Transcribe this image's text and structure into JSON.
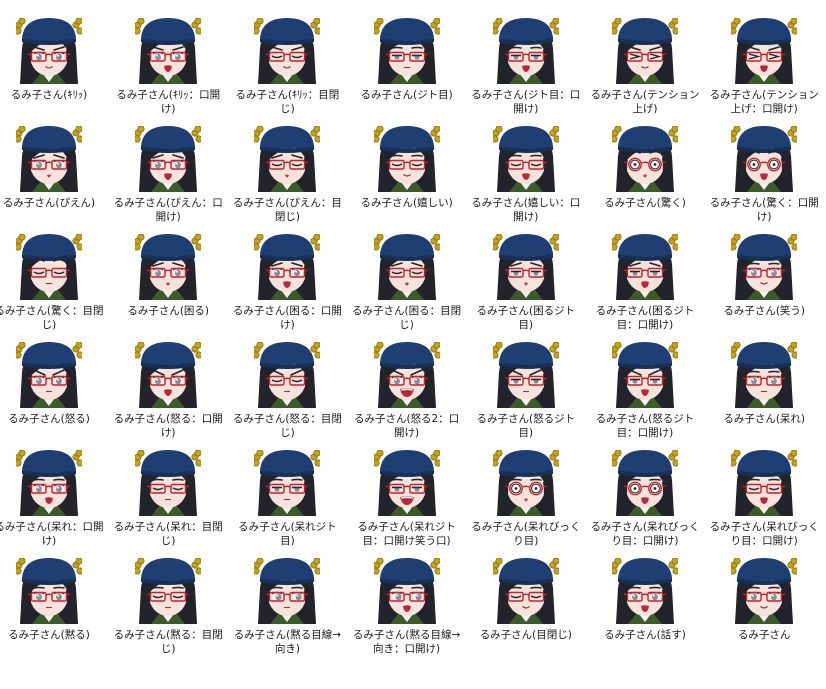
{
  "view": "file-explorer-large-icons",
  "colors": {
    "background": "#ffffff",
    "label_text": "#1a1a1a",
    "hat": "#1f3f73",
    "hat_dark": "#16305a",
    "ribbon": "#c8a20f",
    "hair": "#23232b",
    "skin": "#f6e3dc",
    "glasses_frame": "#c8202a",
    "eye": "#8a8c96",
    "collar": "#3c5a2a"
  },
  "files": [
    {
      "name": "るみ子さん(ｷﾘｯ)",
      "eyes": "normal",
      "brows": "stern",
      "mouth": "smile",
      "glasses": "normal"
    },
    {
      "name": "るみ子さん(ｷﾘｯ：口開け)",
      "eyes": "normal",
      "brows": "stern",
      "mouth": "open",
      "glasses": "normal"
    },
    {
      "name": "るみ子さん(ｷﾘｯ：目閉じ)",
      "eyes": "closed",
      "brows": "stern",
      "mouth": "smile",
      "glasses": "normal"
    },
    {
      "name": "るみ子さん(ジト目)",
      "eyes": "half",
      "brows": "flat",
      "mouth": "flat",
      "glasses": "normal"
    },
    {
      "name": "るみ子さん(ジト目：口開け)",
      "eyes": "half",
      "brows": "flat",
      "mouth": "open",
      "glasses": "normal"
    },
    {
      "name": "るみ子さん(テンション上げ)",
      "eyes": "squint",
      "brows": "stern",
      "mouth": "smile",
      "glasses": "normal"
    },
    {
      "name": "るみ子さん(テンション上げ：口開け)",
      "eyes": "squint",
      "brows": "stern",
      "mouth": "open",
      "glasses": "normal"
    },
    {
      "name": "るみ子さん(ぴえん)",
      "eyes": "normal",
      "brows": "sad",
      "mouth": "small",
      "glasses": "normal"
    },
    {
      "name": "るみ子さん(ぴえん：口開け)",
      "eyes": "normal",
      "brows": "sad",
      "mouth": "open",
      "glasses": "normal"
    },
    {
      "name": "るみ子さん(ぴえん：目閉じ)",
      "eyes": "closed",
      "brows": "sad",
      "mouth": "small",
      "glasses": "normal"
    },
    {
      "name": "るみ子さん(嬉しい)",
      "eyes": "closed",
      "brows": "flat",
      "mouth": "smile",
      "glasses": "normal"
    },
    {
      "name": "るみ子さん(嬉しい：口開け)",
      "eyes": "closed",
      "brows": "flat",
      "mouth": "open",
      "glasses": "normal"
    },
    {
      "name": "るみ子さん(驚く)",
      "eyes": "wide",
      "brows": "surprised",
      "mouth": "small",
      "glasses": "round"
    },
    {
      "name": "るみ子さん(驚く：口開け)",
      "eyes": "wide",
      "brows": "surprised",
      "mouth": "open",
      "glasses": "round"
    },
    {
      "name": "るみ子さん(驚く：目閉じ)",
      "eyes": "closed",
      "brows": "surprised",
      "mouth": "flat",
      "glasses": "normal"
    },
    {
      "name": "るみ子さん(困る)",
      "eyes": "normal",
      "brows": "sad",
      "mouth": "small",
      "glasses": "normal"
    },
    {
      "name": "るみ子さん(困る：口開け)",
      "eyes": "normal",
      "brows": "sad",
      "mouth": "open",
      "glasses": "normal"
    },
    {
      "name": "るみ子さん(困る：目閉じ)",
      "eyes": "closed",
      "brows": "sad",
      "mouth": "small",
      "glasses": "normal"
    },
    {
      "name": "るみ子さん(困るジト目)",
      "eyes": "half",
      "brows": "sad",
      "mouth": "small",
      "glasses": "normal"
    },
    {
      "name": "るみ子さん(困るジト目：口開け)",
      "eyes": "half",
      "brows": "sad",
      "mouth": "open",
      "glasses": "normal"
    },
    {
      "name": "るみ子さん(笑う)",
      "eyes": "normal",
      "brows": "flat",
      "mouth": "smile",
      "glasses": "normal"
    },
    {
      "name": "るみ子さん(怒る)",
      "eyes": "normal",
      "brows": "angry",
      "mouth": "flat",
      "glasses": "normal"
    },
    {
      "name": "るみ子さん(怒る：口開け)",
      "eyes": "normal",
      "brows": "angry",
      "mouth": "open",
      "glasses": "normal"
    },
    {
      "name": "るみ子さん(怒る：目閉じ)",
      "eyes": "closed",
      "brows": "angry",
      "mouth": "flat",
      "glasses": "normal"
    },
    {
      "name": "るみ子さん(怒る2：口開け)",
      "eyes": "normal",
      "brows": "angry",
      "mouth": "wide",
      "glasses": "normal"
    },
    {
      "name": "るみ子さん(怒るジト目)",
      "eyes": "half",
      "brows": "angry",
      "mouth": "flat",
      "glasses": "normal"
    },
    {
      "name": "るみ子さん(怒るジト目：口開け)",
      "eyes": "half",
      "brows": "angry",
      "mouth": "open",
      "glasses": "normal"
    },
    {
      "name": "るみ子さん(呆れ)",
      "eyes": "normal",
      "brows": "flat",
      "mouth": "flat",
      "glasses": "normal"
    },
    {
      "name": "るみ子さん(呆れ：口開け)",
      "eyes": "normal",
      "brows": "flat",
      "mouth": "open",
      "glasses": "normal"
    },
    {
      "name": "るみ子さん(呆れ：目閉じ)",
      "eyes": "closed",
      "brows": "flat",
      "mouth": "flat",
      "glasses": "normal"
    },
    {
      "name": "るみ子さん(呆れジト目)",
      "eyes": "half",
      "brows": "flat",
      "mouth": "flat",
      "glasses": "normal"
    },
    {
      "name": "るみ子さん(呆れジト目：口開け笑う口)",
      "eyes": "half",
      "brows": "flat",
      "mouth": "wide",
      "glasses": "normal"
    },
    {
      "name": "るみ子さん(呆れびっくり目)",
      "eyes": "wide",
      "brows": "flat",
      "mouth": "small",
      "glasses": "round"
    },
    {
      "name": "るみ子さん(呆れびっくり目：口開け)",
      "eyes": "wide",
      "brows": "flat",
      "mouth": "open",
      "glasses": "round"
    },
    {
      "name": "るみ子さん(呆れびっくり目：口開け)",
      "eyes": "closed",
      "brows": "flat",
      "mouth": "open",
      "glasses": "normal"
    },
    {
      "name": "るみ子さん(黙る)",
      "eyes": "normal",
      "brows": "flat",
      "mouth": "flat",
      "glasses": "normal"
    },
    {
      "name": "るみ子さん(黙る：目閉じ)",
      "eyes": "closed",
      "brows": "flat",
      "mouth": "flat",
      "glasses": "normal"
    },
    {
      "name": "るみ子さん(黙る目線→向き)",
      "eyes": "side",
      "brows": "flat",
      "mouth": "flat",
      "glasses": "normal"
    },
    {
      "name": "るみ子さん(黙る目線→向き：口開け)",
      "eyes": "side",
      "brows": "flat",
      "mouth": "open",
      "glasses": "normal"
    },
    {
      "name": "るみ子さん(目閉じ)",
      "eyes": "closed",
      "brows": "flat",
      "mouth": "smile",
      "glasses": "normal"
    },
    {
      "name": "るみ子さん(話す)",
      "eyes": "normal",
      "brows": "flat",
      "mouth": "open",
      "glasses": "normal"
    },
    {
      "name": "るみ子さん",
      "eyes": "normal",
      "brows": "flat",
      "mouth": "smile",
      "glasses": "normal"
    }
  ]
}
